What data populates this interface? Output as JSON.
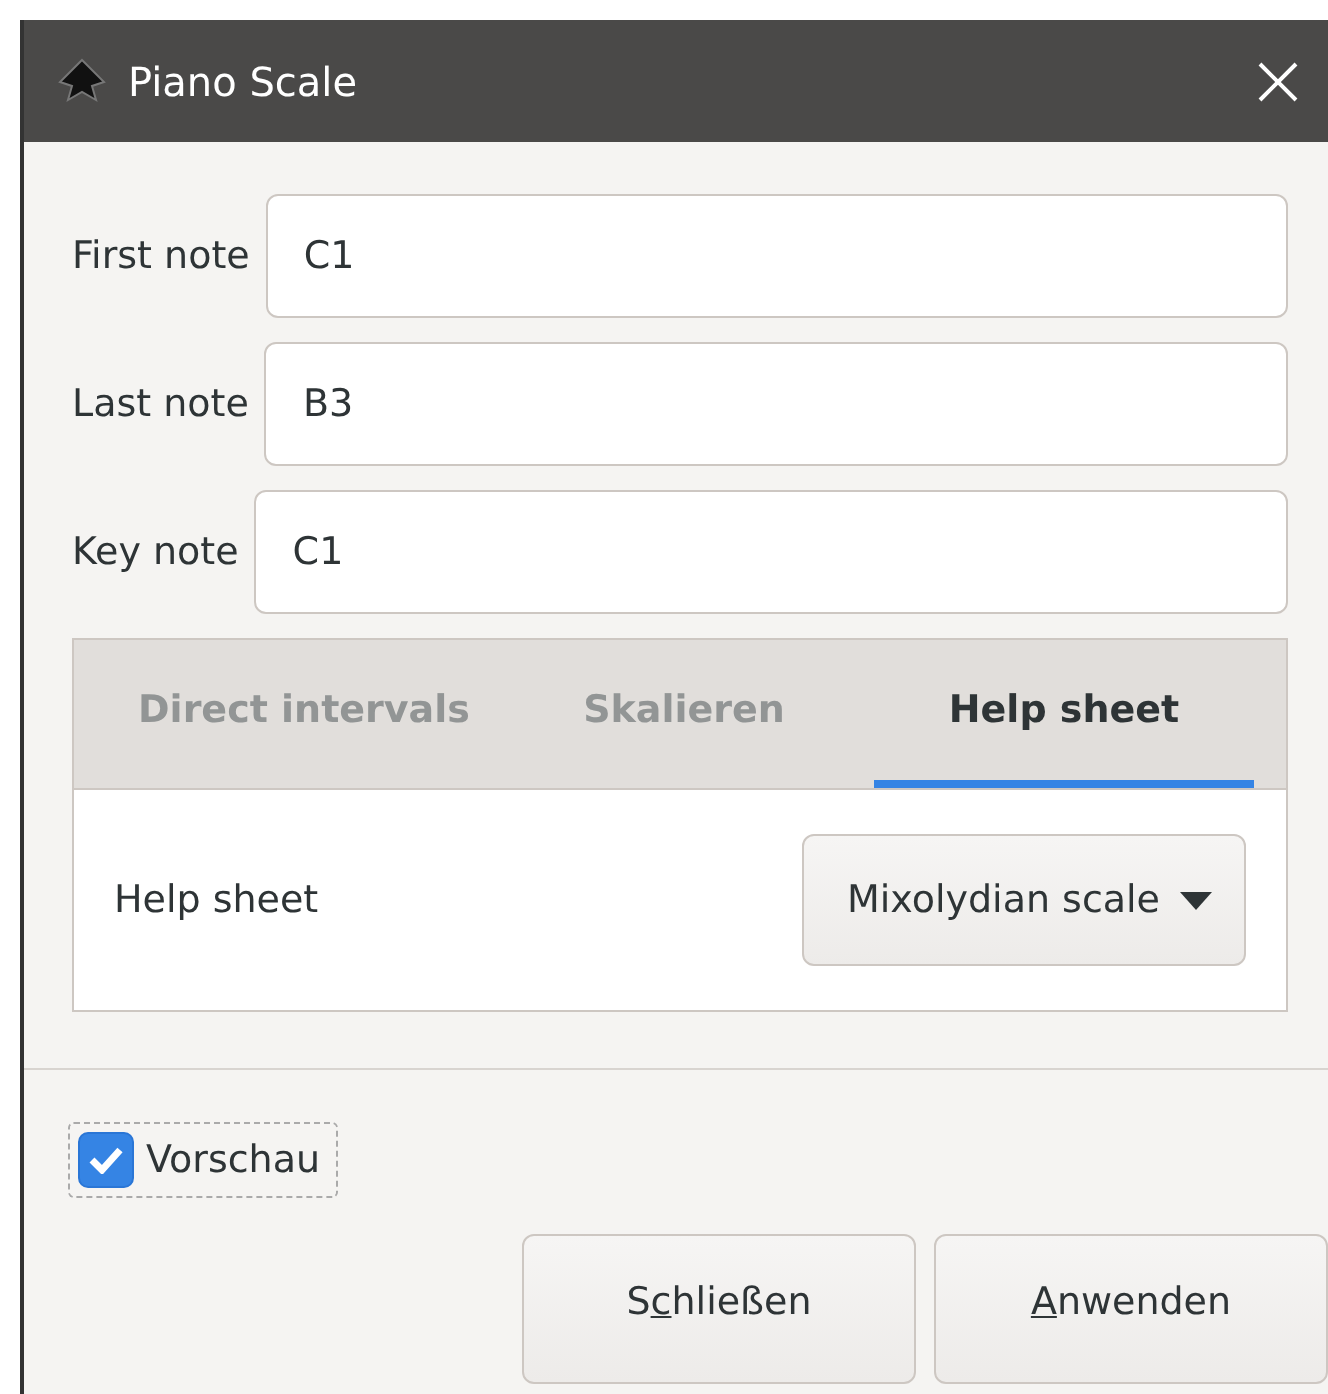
{
  "window": {
    "title": "Piano Scale"
  },
  "fields": [
    {
      "label": "First note",
      "value": "C1"
    },
    {
      "label": "Last note",
      "value": "B3"
    },
    {
      "label": "Key note",
      "value": "C1"
    }
  ],
  "tabs": [
    {
      "label": "Direct intervals",
      "selected": false
    },
    {
      "label": "Skalieren",
      "selected": false
    },
    {
      "label": "Help sheet",
      "selected": true
    }
  ],
  "tab_content": {
    "label": "Help sheet",
    "dropdown": "Mixolydian scale"
  },
  "preview": {
    "label": "Vorschau",
    "checked": true
  },
  "buttons": [
    {
      "before": "S",
      "mnemonic": "c",
      "after": "hließen"
    },
    {
      "mnemonic": "A",
      "after": "nwenden"
    }
  ]
}
